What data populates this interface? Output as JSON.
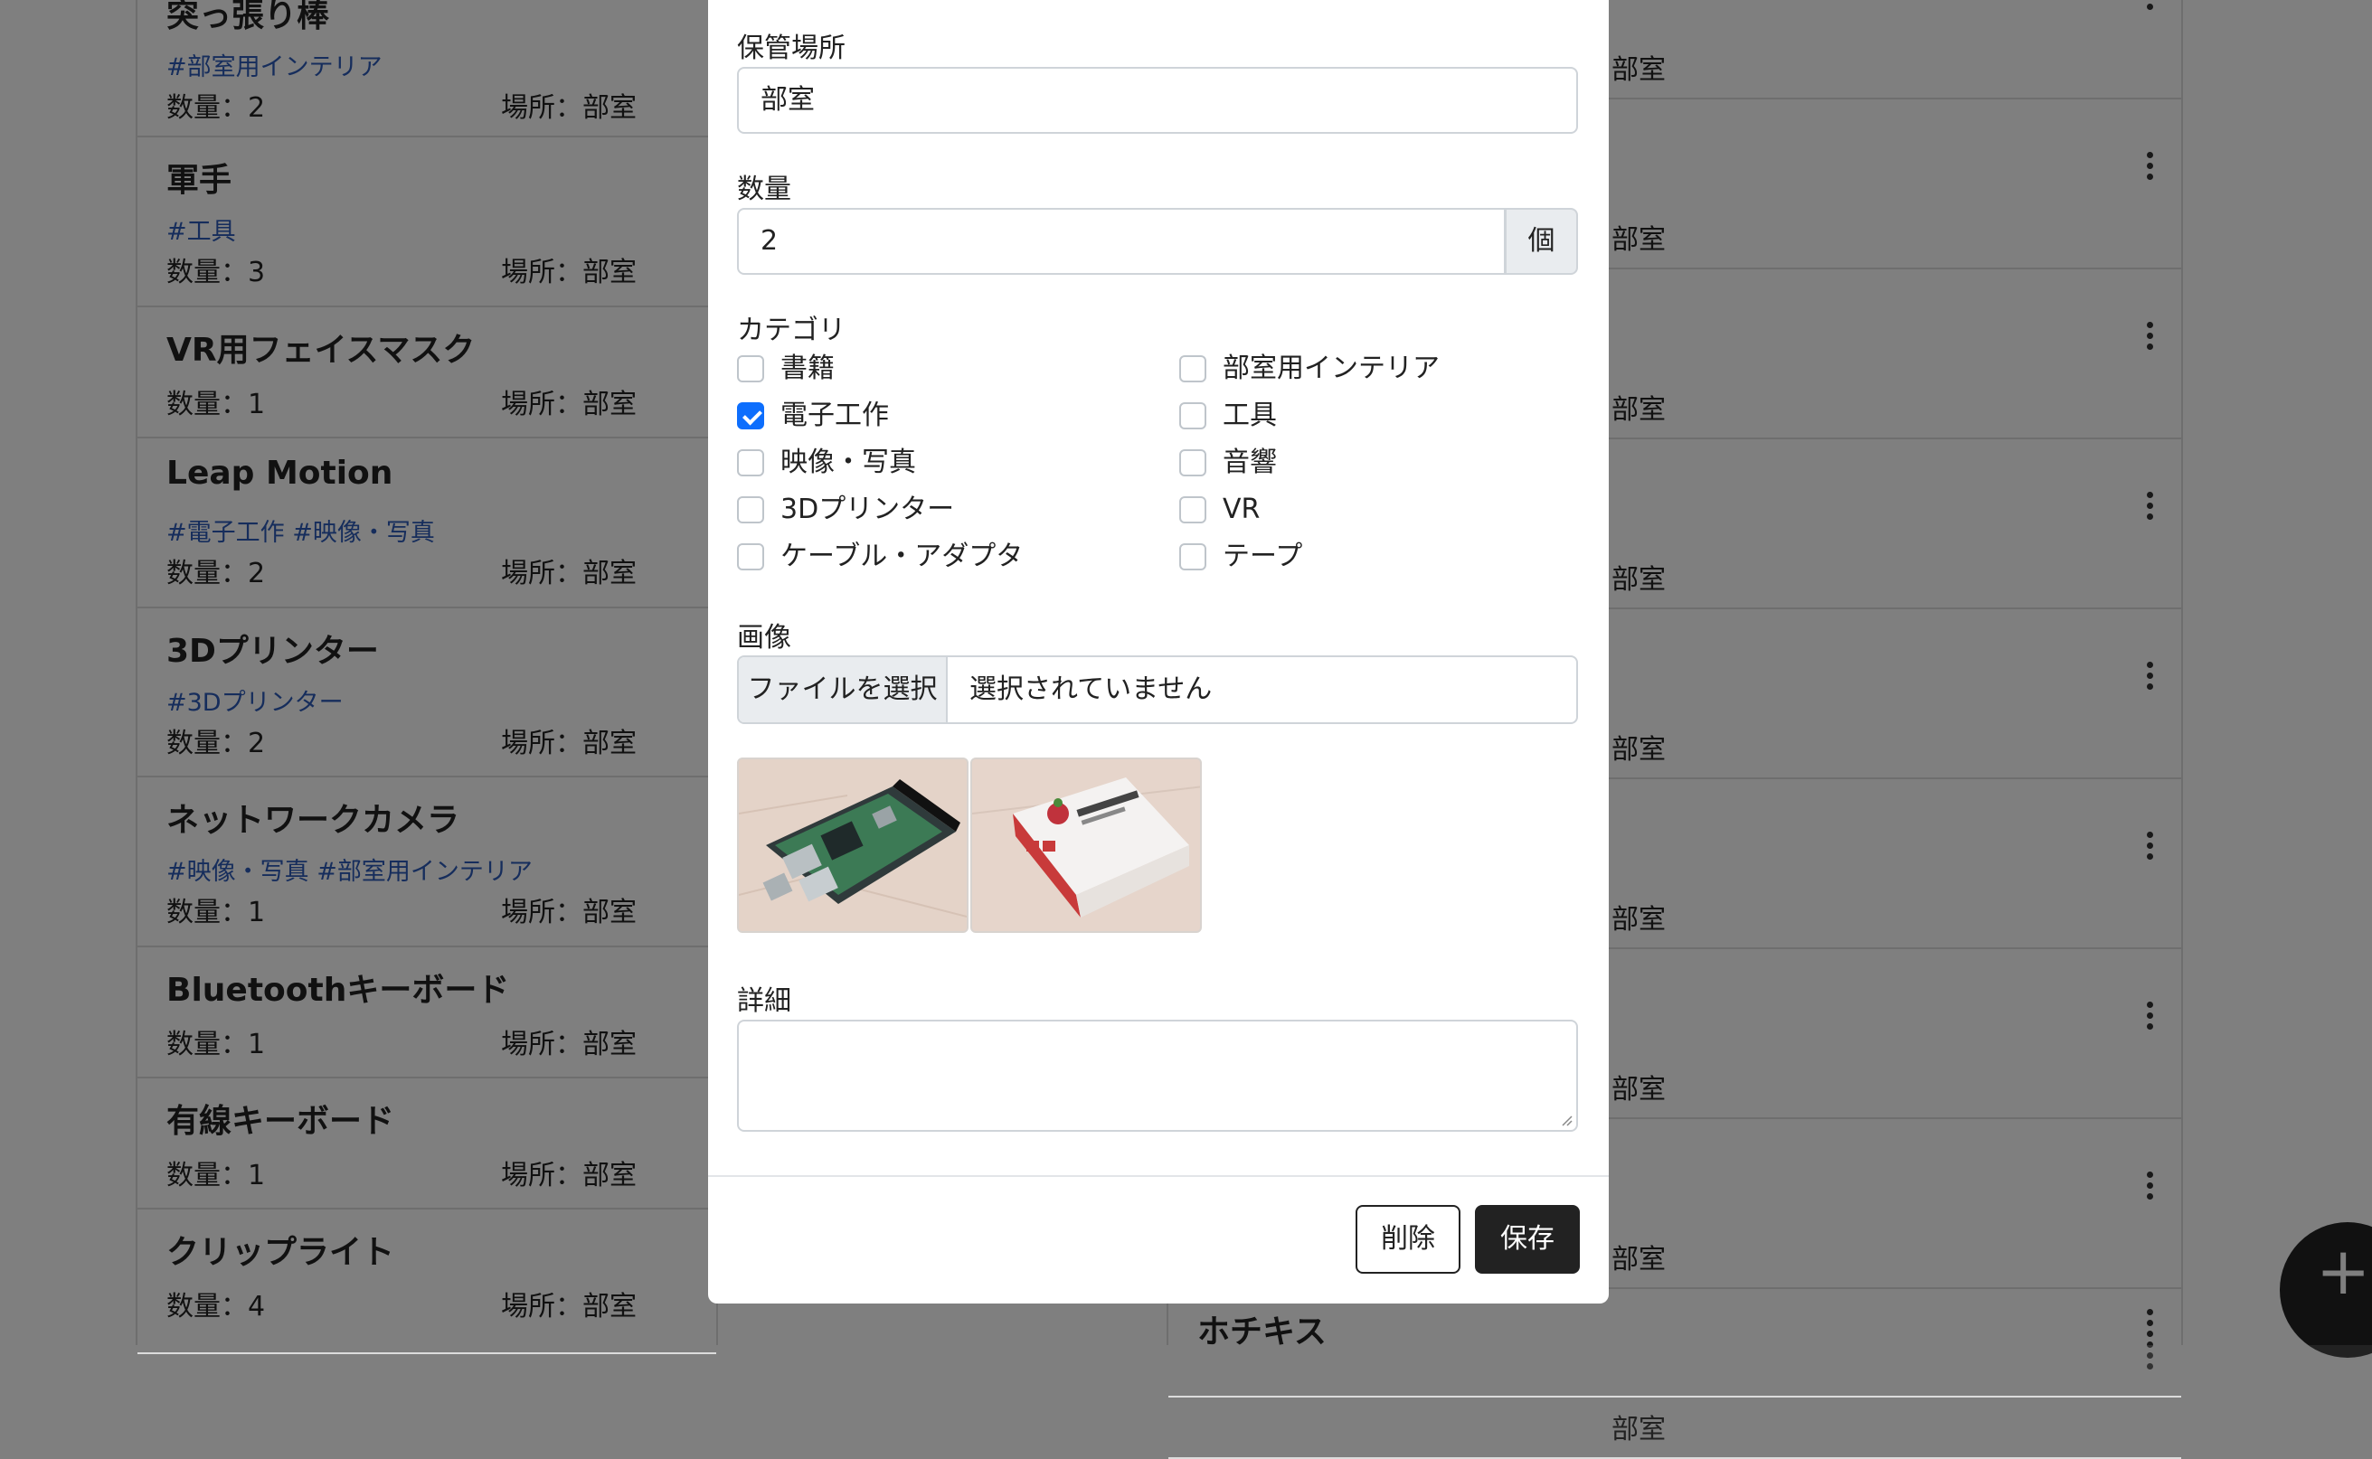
{
  "background": {
    "left_items": [
      {
        "title": "突っ張り棒",
        "tags": "#部室用インテリア",
        "quantity": "数量：2",
        "location": "場所：部室"
      },
      {
        "title": "軍手",
        "tags": "#工具",
        "quantity": "数量：3",
        "location": "場所：部室"
      },
      {
        "title": "VR用フェイスマスク",
        "tags": "",
        "quantity": "数量：1",
        "location": "場所：部室"
      },
      {
        "title": "Leap Motion",
        "tags": "#電子工作 #映像・写真",
        "quantity": "数量：2",
        "location": "場所：部室"
      },
      {
        "title": "3Dプリンター",
        "tags": "#3Dプリンター",
        "quantity": "数量：2",
        "location": "場所：部室"
      },
      {
        "title": "ネットワークカメラ",
        "tags": "#映像・写真 #部室用インテリア",
        "quantity": "数量：1",
        "location": "場所：部室"
      },
      {
        "title": "Bluetoothキーボード",
        "tags": "",
        "quantity": "数量：1",
        "location": "場所：部室"
      },
      {
        "title": "有線キーボード",
        "tags": "",
        "quantity": "数量：1",
        "location": "場所：部室"
      },
      {
        "title": "クリップライト",
        "tags": "",
        "quantity": "数量：4",
        "location": "場所：部室"
      }
    ],
    "right_items": [
      {
        "location": "部室"
      },
      {
        "location": "部室"
      },
      {
        "location": "部室"
      },
      {
        "location": "部室"
      },
      {
        "location": "部室"
      },
      {
        "location": "部室"
      },
      {
        "location": "部室"
      },
      {
        "location": "部室"
      },
      {
        "location": "部室"
      }
    ],
    "right_last_title": "ホチキス",
    "fab_label": "+"
  },
  "modal": {
    "storage_label": "保管場所",
    "storage_value": "部室",
    "quantity_label": "数量",
    "quantity_value": "2",
    "quantity_unit": "個",
    "category_label": "カテゴリ",
    "categories": [
      {
        "label": "書籍",
        "checked": false
      },
      {
        "label": "部室用インテリア",
        "checked": false
      },
      {
        "label": "電子工作",
        "checked": true
      },
      {
        "label": "工具",
        "checked": false
      },
      {
        "label": "映像・写真",
        "checked": false
      },
      {
        "label": "音響",
        "checked": false
      },
      {
        "label": "3Dプリンター",
        "checked": false
      },
      {
        "label": "VR",
        "checked": false
      },
      {
        "label": "ケーブル・アダプタ",
        "checked": false
      },
      {
        "label": "テープ",
        "checked": false
      }
    ],
    "image_label": "画像",
    "file_button": "ファイルを選択",
    "file_status": "選択されていません",
    "detail_label": "詳細",
    "detail_value": "",
    "delete_button": "削除",
    "save_button": "保存"
  },
  "colors": {
    "accent": "#0d6efd",
    "tag": "#2c5ab8",
    "primary_button": "#222222"
  }
}
